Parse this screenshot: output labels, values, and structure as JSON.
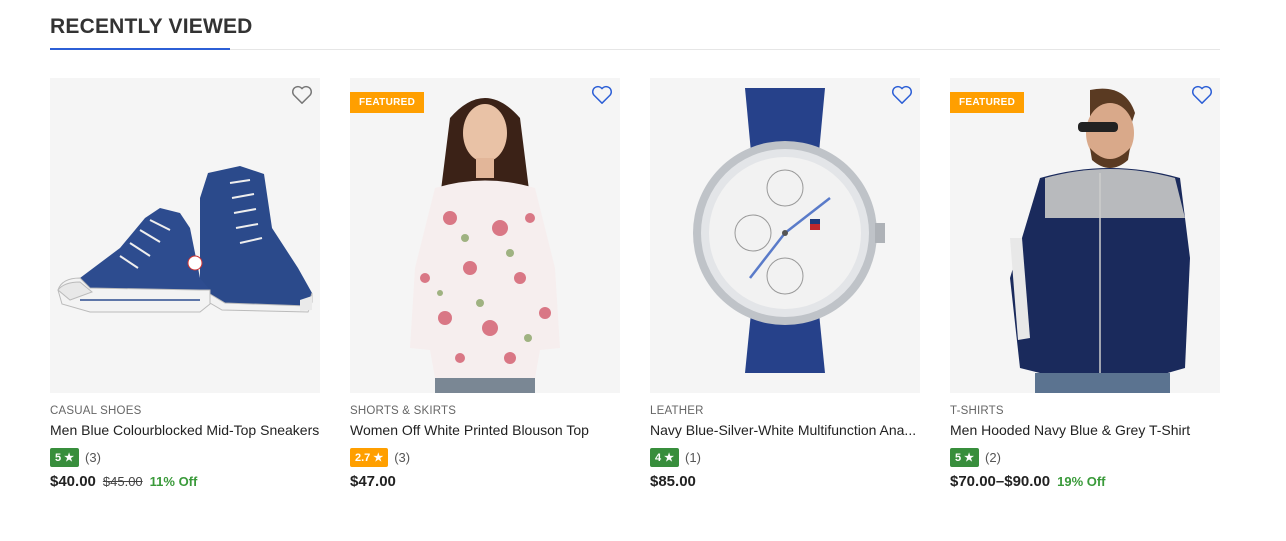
{
  "section": {
    "title": "RECENTLY VIEWED"
  },
  "colors": {
    "accent": "#2c5fd6",
    "featured": "#ff9f00",
    "rating_high": "#388e3c",
    "rating_mid": "#ff9f00",
    "discount": "#3a9a3a"
  },
  "products": [
    {
      "category": "CASUAL SHOES",
      "title": "Men Blue Colourblocked Mid-Top Sneakers",
      "rating": "5 ★",
      "rating_count": "(3)",
      "price": "$40.00",
      "old_price": "$45.00",
      "discount": "11% Off",
      "featured": "",
      "image": "blue-sneakers",
      "wishlist_icon": "heart-outline-icon"
    },
    {
      "category": "SHORTS & SKIRTS",
      "title": "Women Off White Printed Blouson Top",
      "rating": "2.7 ★",
      "rating_count": "(3)",
      "price": "$47.00",
      "old_price": "",
      "discount": "",
      "featured": "FEATURED",
      "image": "floral-blouse-model",
      "wishlist_icon": "heart-outline-icon"
    },
    {
      "category": "LEATHER",
      "title": "Navy Blue-Silver-White Multifunction Ana...",
      "rating": "4 ★",
      "rating_count": "(1)",
      "price": "$85.00",
      "old_price": "",
      "discount": "",
      "featured": "",
      "image": "navy-leather-watch",
      "wishlist_icon": "heart-outline-icon"
    },
    {
      "category": "T-SHIRTS",
      "title": "Men Hooded Navy Blue & Grey T-Shirt",
      "rating": "5 ★",
      "rating_count": "(2)",
      "price": "$70.00–$90.00",
      "old_price": "",
      "discount": "19% Off",
      "featured": "FEATURED",
      "image": "navy-grey-jacket-model",
      "wishlist_icon": "heart-outline-icon"
    }
  ]
}
